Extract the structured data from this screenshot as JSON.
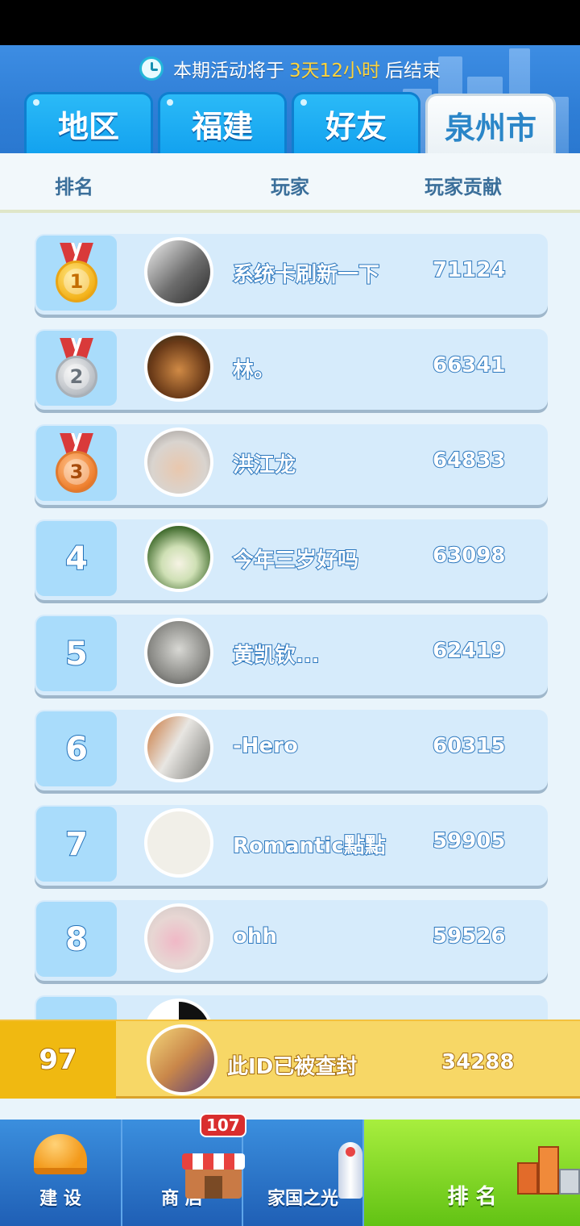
{
  "header": {
    "timer_prefix": "本期活动将于",
    "timer_highlight": "3天12小时",
    "timer_suffix": "后结束"
  },
  "tabs": [
    {
      "label": "地区",
      "active": false
    },
    {
      "label": "福建",
      "active": false
    },
    {
      "label": "好友",
      "active": false
    },
    {
      "label": "泉州市",
      "active": true
    }
  ],
  "columns": {
    "rank": "排名",
    "player": "玩家",
    "contribution": "玩家贡献"
  },
  "rows": [
    {
      "rank": "1",
      "medal": "gold-medal",
      "medal_label": "1",
      "name": "系统卡刷新一下",
      "score": "71124"
    },
    {
      "rank": "2",
      "medal": "silver-medal",
      "medal_label": "2",
      "name": "林。",
      "score": "66341"
    },
    {
      "rank": "3",
      "medal": "bronze-medal",
      "medal_label": "3",
      "name": "洪江龙",
      "score": "64833"
    },
    {
      "rank": "4",
      "name": "今年三岁好吗",
      "score": "63098"
    },
    {
      "rank": "5",
      "name": "黄凯钦...",
      "score": "62419"
    },
    {
      "rank": "6",
      "name": "-Hero",
      "score": "60315"
    },
    {
      "rank": "7",
      "name": "Romantic點點",
      "score": "59905"
    },
    {
      "rank": "8",
      "name": "ohh",
      "score": "59526"
    }
  ],
  "avatar_colors": [
    "#6d6d6d",
    "#b86a2f",
    "#cfc9c4",
    "#5c8a3a",
    "#8c8c88",
    "#b88a55",
    "#f1efe8",
    "#e7d6d3",
    "#222222"
  ],
  "my_entry": {
    "rank": "97",
    "name": "此ID已被查封",
    "score": "34288"
  },
  "nav": {
    "items": [
      {
        "label": "建 设",
        "icon": "helmet-icon"
      },
      {
        "label": "商 店",
        "icon": "shop-icon"
      },
      {
        "label": "家国之光",
        "icon": "rocket-icon"
      },
      {
        "label": "排 名",
        "icon": "podium-icon"
      }
    ],
    "shop_badge": "107"
  }
}
